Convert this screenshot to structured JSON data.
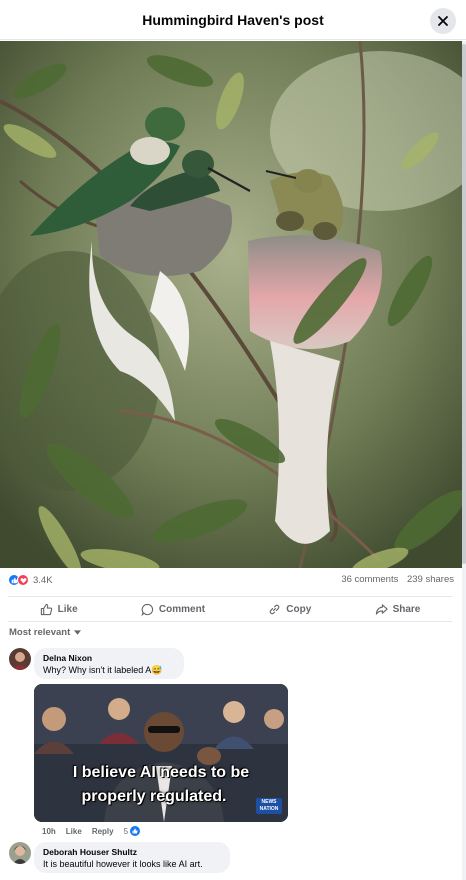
{
  "header": {
    "title": "Hummingbird Haven's post"
  },
  "post": {
    "reactions_count": "3.4K",
    "comments_label": "36 comments",
    "shares_label": "239 shares",
    "actions": {
      "like": "Like",
      "comment": "Comment",
      "copy": "Copy",
      "share": "Share"
    }
  },
  "comments_sort": "Most relevant",
  "comments": [
    {
      "author": "Delna Nixon",
      "text": "Why? Why isn't it labeled A",
      "emoji": "😅",
      "gif_caption_line1": "I believe AI needs to be",
      "gif_caption_line2": "properly regulated.",
      "gif_badge": "NEWS NATION",
      "time": "10h",
      "like_label": "Like",
      "reply_label": "Reply",
      "reaction_count": "5"
    },
    {
      "author": "Deborah Houser Shultz",
      "text": "It is beautiful however it looks like AI art."
    }
  ],
  "colors": {
    "accent": "#1877f2",
    "love": "#f33e58",
    "muted": "#65676b",
    "bubble": "#f0f2f5"
  }
}
